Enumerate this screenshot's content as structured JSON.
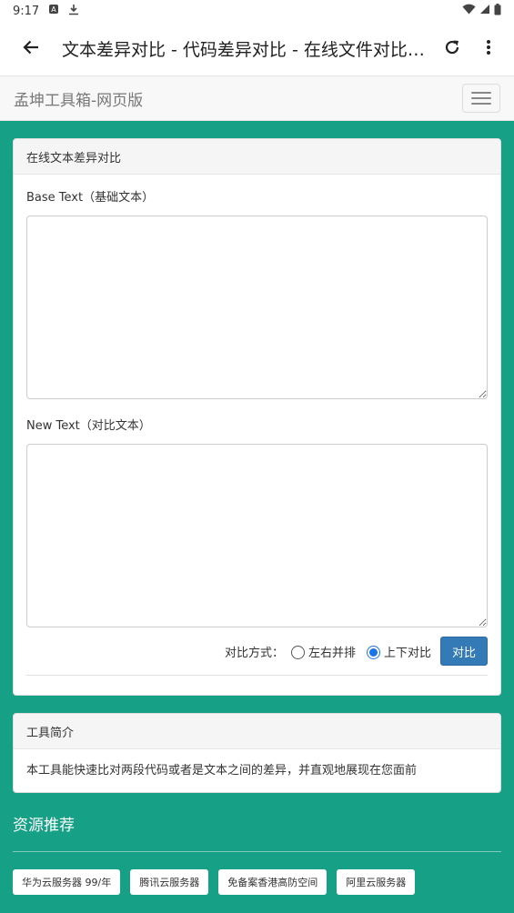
{
  "status_bar": {
    "time": "9:17"
  },
  "app_bar": {
    "title": "文本差异对比 - 代码差异对比 - 在线文件对比工具"
  },
  "navbar": {
    "brand": "孟坤工具箱-网页版"
  },
  "diff_panel": {
    "heading": "在线文本差异对比",
    "base_label": "Base Text（基础文本）",
    "base_value": "",
    "new_label": "New Text（对比文本）",
    "new_value": "",
    "mode_label": "对比方式：",
    "mode_options": [
      "左右并排",
      "上下对比"
    ],
    "mode_selected": "上下对比",
    "compare_button": "对比"
  },
  "intro_panel": {
    "heading": "工具简介",
    "text": "本工具能快速比对两段代码或者是文本之间的差异，并直观地展现在您面前"
  },
  "resources": {
    "title": "资源推荐",
    "links": [
      "华为云服务器 99/年",
      "腾讯云服务器",
      "免备案香港高防空间",
      "阿里云服务器"
    ]
  },
  "colors": {
    "page_background": "#16a085",
    "primary_button": "#337ab7",
    "radio_checked": "#1a73e8"
  },
  "icons": {
    "status": [
      "notification-icon",
      "download-icon",
      "wifi-icon",
      "signal-icon",
      "battery-icon"
    ],
    "app_bar": [
      "back-arrow-icon",
      "refresh-icon",
      "more-vert-icon"
    ],
    "navbar": [
      "hamburger-menu-icon"
    ]
  }
}
